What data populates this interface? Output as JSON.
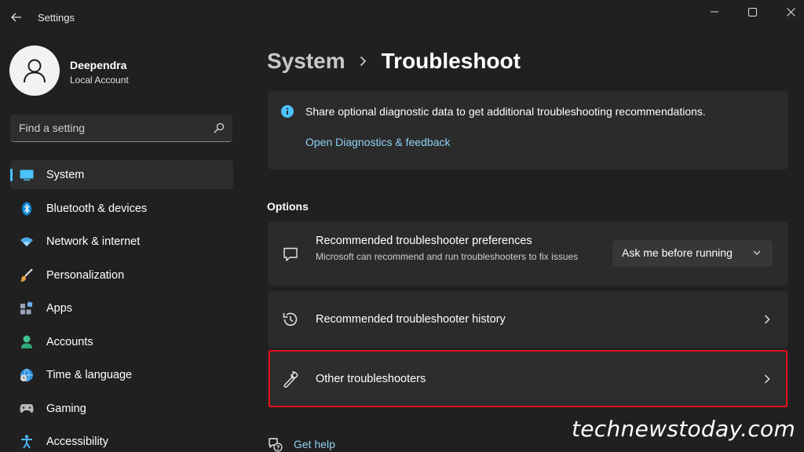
{
  "window": {
    "title": "Settings"
  },
  "profile": {
    "name": "Deependra",
    "account_type": "Local Account"
  },
  "search": {
    "placeholder": "Find a setting",
    "value": ""
  },
  "sidebar": {
    "items": [
      {
        "label": "System",
        "icon": "system-display-icon",
        "active": true
      },
      {
        "label": "Bluetooth & devices",
        "icon": "bluetooth-icon",
        "active": false
      },
      {
        "label": "Network & internet",
        "icon": "wifi-icon",
        "active": false
      },
      {
        "label": "Personalization",
        "icon": "brush-icon",
        "active": false
      },
      {
        "label": "Apps",
        "icon": "apps-icon",
        "active": false
      },
      {
        "label": "Accounts",
        "icon": "person-icon",
        "active": false
      },
      {
        "label": "Time & language",
        "icon": "globe-clock-icon",
        "active": false
      },
      {
        "label": "Gaming",
        "icon": "gamepad-icon",
        "active": false
      },
      {
        "label": "Accessibility",
        "icon": "accessibility-icon",
        "active": false
      }
    ]
  },
  "breadcrumb": {
    "parent": "System",
    "current": "Troubleshoot"
  },
  "info": {
    "text": "Share optional diagnostic data to get additional troubleshooting recommendations.",
    "link": "Open Diagnostics & feedback"
  },
  "options": {
    "heading": "Options",
    "items": [
      {
        "title": "Recommended troubleshooter preferences",
        "description": "Microsoft can recommend and run troubleshooters to fix issues",
        "icon": "chat-message-icon",
        "dropdown_value": "Ask me before running"
      },
      {
        "title": "Recommended troubleshooter history",
        "icon": "history-icon"
      },
      {
        "title": "Other troubleshooters",
        "icon": "wrench-icon"
      }
    ]
  },
  "help": {
    "label": "Get help"
  },
  "watermark": "technewstoday.com",
  "colors": {
    "background": "#202020",
    "card": "#2b2b2b",
    "accent": "#4cc2ff",
    "link": "#8fd3f5",
    "highlight_border": "#e0101a"
  }
}
